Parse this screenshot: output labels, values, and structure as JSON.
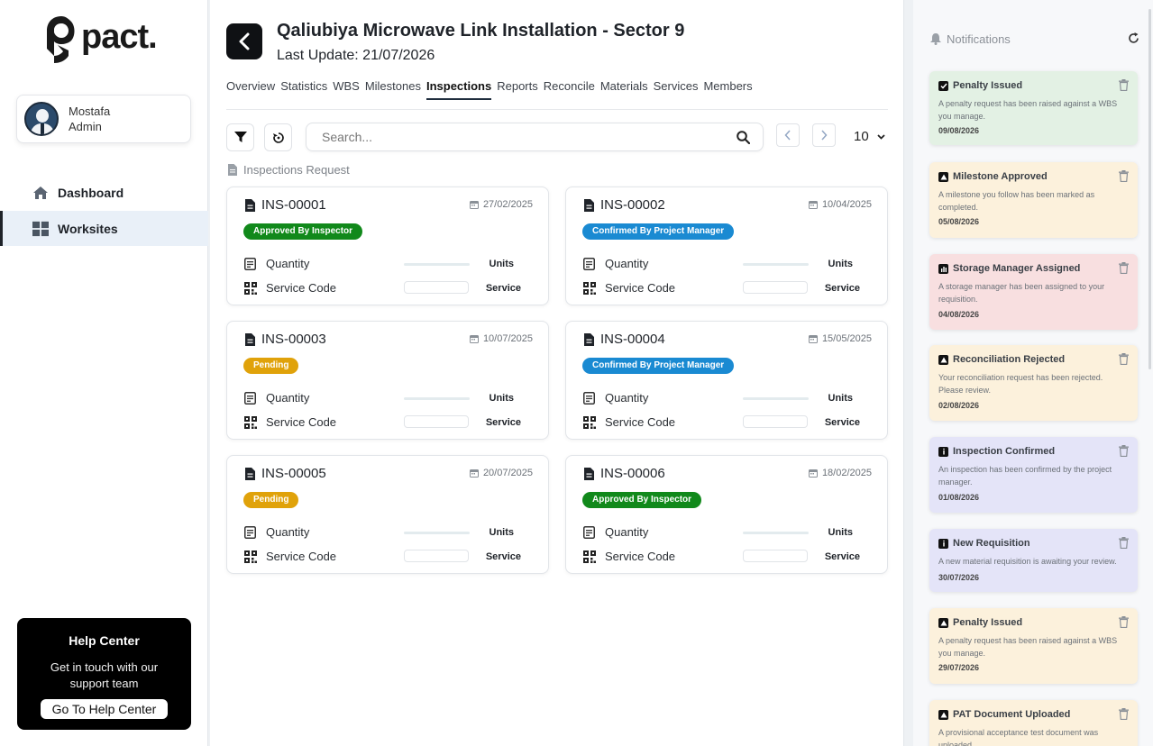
{
  "brand": {
    "name": "pact."
  },
  "user": {
    "name": "Mostafa",
    "role": "Admin"
  },
  "nav": [
    {
      "label": "Dashboard",
      "icon": "home-icon",
      "active": false
    },
    {
      "label": "Worksites",
      "icon": "grid-icon",
      "active": true
    }
  ],
  "help": {
    "title": "Help Center",
    "text": "Get in touch with our support team",
    "button": "Go To Help Center"
  },
  "project": {
    "title": "Qaliubiya Microwave Link Installation - Sector 9",
    "last_update": "Last Update: 21/07/2026"
  },
  "tabs": [
    "Overview",
    "Statistics",
    "WBS",
    "Milestones",
    "Inspections",
    "Reports",
    "Reconcile",
    "Materials",
    "Services",
    "Members"
  ],
  "active_tab": "Inspections",
  "search": {
    "placeholder": "Search..."
  },
  "pagination": {
    "per_page": "10"
  },
  "section_label": "Inspections Request",
  "labels": {
    "quantity": "Quantity",
    "service_code": "Service Code",
    "units": "Units",
    "service": "Service"
  },
  "inspections": [
    {
      "id": "INS-00001",
      "date": "27/02/2025",
      "status": "Approved By Inspector",
      "status_color": "#11891b"
    },
    {
      "id": "INS-00002",
      "date": "10/04/2025",
      "status": "Confirmed By Project Manager",
      "status_color": "#1a8ad2"
    },
    {
      "id": "INS-00003",
      "date": "10/07/2025",
      "status": "Pending",
      "status_color": "#e0a20a"
    },
    {
      "id": "INS-00004",
      "date": "15/05/2025",
      "status": "Confirmed By Project Manager",
      "status_color": "#1a8ad2"
    },
    {
      "id": "INS-00005",
      "date": "20/07/2025",
      "status": "Pending",
      "status_color": "#e0a20a"
    },
    {
      "id": "INS-00006",
      "date": "18/02/2025",
      "status": "Approved By Inspector",
      "status_color": "#11891b"
    }
  ],
  "notifications_title": "Notifications",
  "notifications": [
    {
      "title": "Penalty Issued",
      "desc": "A penalty request has been raised against a WBS you manage.",
      "date": "09/08/2026",
      "bg": "#e3f1e4",
      "icon": "check-icon"
    },
    {
      "title": "Milestone Approved",
      "desc": "A milestone you follow has been marked as completed.",
      "date": "05/08/2026",
      "bg": "#fcf1dc",
      "icon": "warning-icon"
    },
    {
      "title": "Storage Manager Assigned",
      "desc": "A storage manager has been assigned to your requisition.",
      "date": "04/08/2026",
      "bg": "#f8dfe0",
      "icon": "chart-icon"
    },
    {
      "title": "Reconciliation Rejected",
      "desc": "Your reconciliation request has been rejected. Please review.",
      "date": "02/08/2026",
      "bg": "#fcf1dc",
      "icon": "warning-icon"
    },
    {
      "title": "Inspection Confirmed",
      "desc": "An inspection has been confirmed by the project manager.",
      "date": "01/08/2026",
      "bg": "#e4e4f8",
      "icon": "info-icon"
    },
    {
      "title": "New Requisition",
      "desc": "A new material requisition is awaiting your review.",
      "date": "30/07/2026",
      "bg": "#e4e4f8",
      "icon": "info-icon"
    },
    {
      "title": "Penalty Issued",
      "desc": "A penalty request has been raised against a WBS you manage.",
      "date": "29/07/2026",
      "bg": "#fcf1dc",
      "icon": "warning-icon"
    },
    {
      "title": "PAT Document Uploaded",
      "desc": "A provisional acceptance test document was uploaded.",
      "date": "",
      "bg": "#fcf1dc",
      "icon": "warning-icon"
    }
  ]
}
